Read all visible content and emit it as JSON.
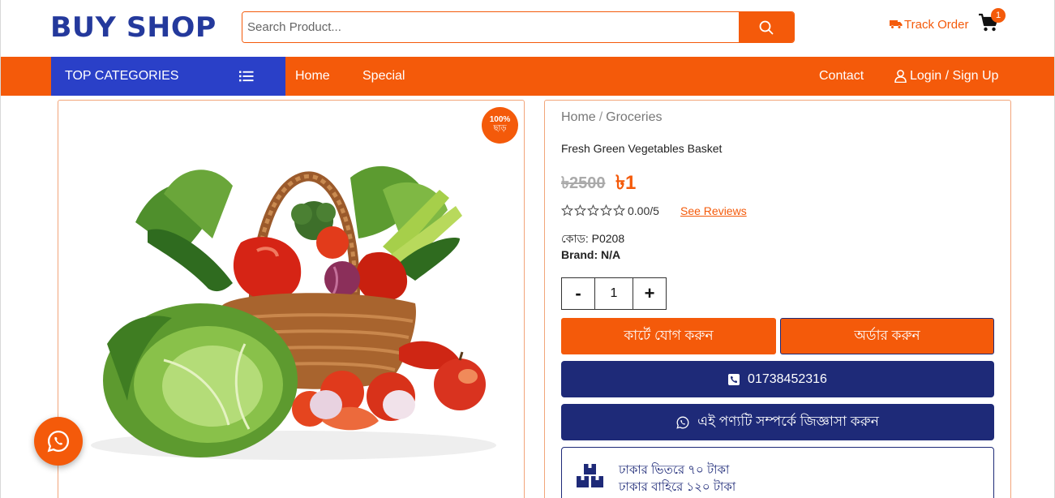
{
  "brand": {
    "logo_text": "BUY SHOP",
    "primary_color": "#f45a0a",
    "secondary_color": "#2a40c8",
    "dark_color": "#1e2a78"
  },
  "header": {
    "search_placeholder": "Search Product...",
    "search_icon": "search-icon",
    "track_order_label": "Track Order",
    "cart_count": "1"
  },
  "nav": {
    "categories_label": "TOP CATEGORIES",
    "links": {
      "home": "Home",
      "special": "Special",
      "contact": "Contact",
      "login": "Login / Sign Up"
    }
  },
  "product": {
    "discount_line1": "100%",
    "discount_line2": "ছাড়",
    "breadcrumb_home": "Home",
    "breadcrumb_sep": "/",
    "breadcrumb_category": "Groceries",
    "name": "Fresh Green Vegetables Basket",
    "old_price": "৳2500",
    "new_price": "৳1",
    "rating_text": "0.00/5",
    "rating_value": 0,
    "rating_max": 5,
    "see_reviews": "See Reviews",
    "code_text": "কোড: P0208",
    "brand_text": "Brand: N/A",
    "qty_minus": "-",
    "qty_value": "1",
    "qty_plus": "+",
    "add_to_cart": "কার্টে যোগ করুন",
    "order_now": "অর্ডার করুন",
    "phone": "01738452316",
    "ask": "এই পণ্যটি সম্পর্কে জিজ্ঞাসা করুন",
    "delivery_inside": "ঢাকার ভিতরে ৭০ টাকা",
    "delivery_outside": "ঢাকার বাহিরে ১২০ টাকা"
  }
}
